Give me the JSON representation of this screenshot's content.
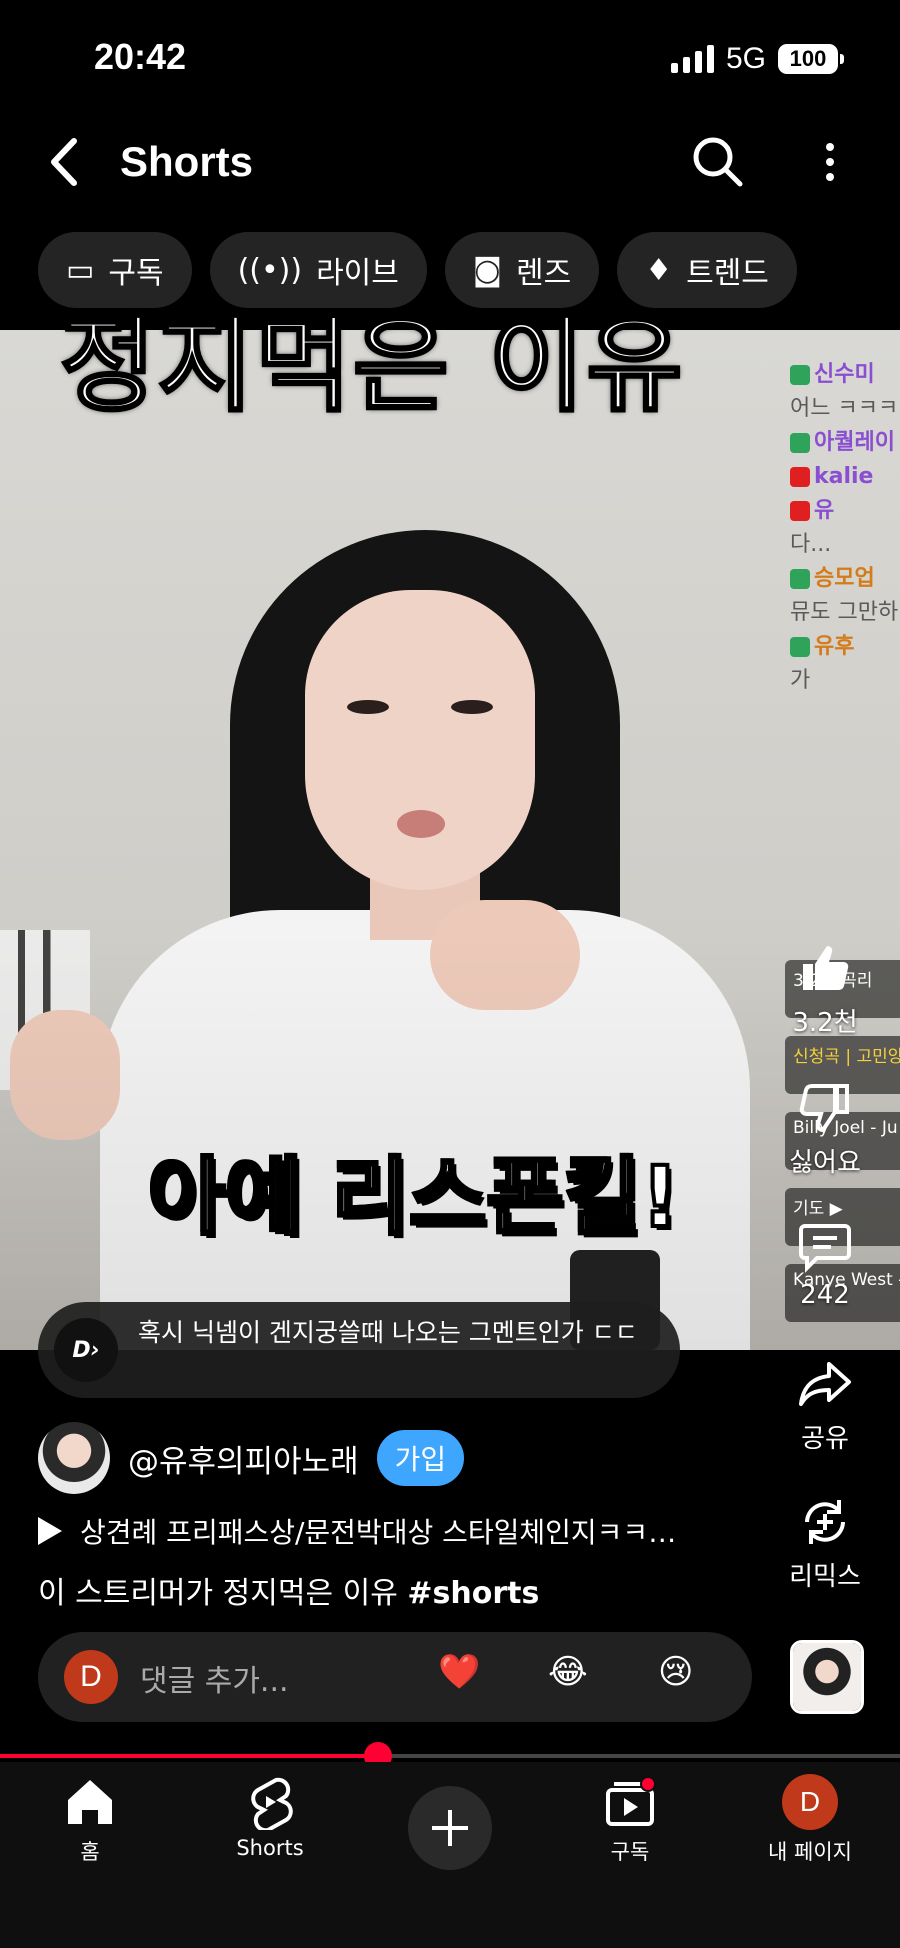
{
  "status": {
    "time": "20:42",
    "network": "5G",
    "battery": "100"
  },
  "header": {
    "title": "Shorts"
  },
  "chips": [
    {
      "label": "구독",
      "icon": "subscriptions-icon"
    },
    {
      "label": "라이브",
      "icon": "live-icon"
    },
    {
      "label": "렌즈",
      "icon": "lens-icon"
    },
    {
      "label": "트렌드",
      "icon": "trending-icon"
    }
  ],
  "video": {
    "overlay_title": "정지먹은 이유",
    "caption": "아예 리스폰킬!",
    "chat": [
      {
        "name": "신수미",
        "text": ""
      },
      {
        "name": "",
        "text": "어느 ㅋㅋㅋ"
      },
      {
        "name": "아퀄레이",
        "text": ""
      },
      {
        "name": "kalie",
        "text": ""
      },
      {
        "name": "유",
        "text": ""
      },
      {
        "name": "",
        "text": "다..."
      },
      {
        "name": "승모업",
        "text": ""
      },
      {
        "name": "",
        "text": "뮤도 그만하"
      },
      {
        "name": "유후",
        "text": ""
      },
      {
        "name": "",
        "text": "가"
      }
    ],
    "playlist": [
      {
        "text": "3.2천 곡리"
      },
      {
        "text": "신청곡 | 고민앙"
      },
      {
        "text": "Billy Joel - Ju"
      },
      {
        "text": "기도 ▶"
      },
      {
        "text": "Kanye West -"
      }
    ]
  },
  "actions": {
    "like_count": "3.2천",
    "dislike_label": "싫어요",
    "comment_count": "242",
    "share_label": "공유",
    "remix_label": "리믹스"
  },
  "pinned_comment": {
    "brand": "DAIWA",
    "text": "혹시 닉넴이 겐지궁쓸때 나오는 그멘트인가 ㄷㄷ"
  },
  "channel": {
    "name": "@유후의피아노래",
    "join_label": "가입"
  },
  "music": {
    "title": "상견례 프리패스상/문전박대상 스타일체인지ㅋㅋ…"
  },
  "description": {
    "text": "이 스트리머가 정지먹은 이유 ",
    "hashtag": "#shorts"
  },
  "comment_bar": {
    "avatar_letter": "D",
    "placeholder": "댓글 추가...",
    "emojis": [
      "❤️",
      "😂",
      "😢"
    ]
  },
  "progress": {
    "fraction": 0.42
  },
  "nav": {
    "home": "홈",
    "shorts": "Shorts",
    "subscriptions": "구독",
    "profile": "내 페이지",
    "profile_letter": "D"
  },
  "colors": {
    "accent_red": "#ff0033",
    "join_blue": "#3ea6ff"
  }
}
